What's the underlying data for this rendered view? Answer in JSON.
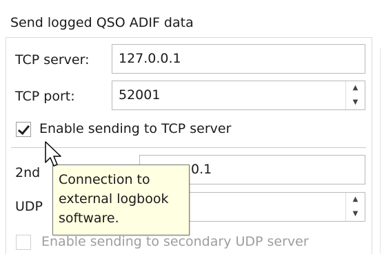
{
  "group": {
    "title": "Send logged QSO ADIF data"
  },
  "tcp_server": {
    "label": "TCP server:",
    "value": "127.0.0.1"
  },
  "tcp_port": {
    "label": "TCP port:",
    "value": "52001"
  },
  "enable_tcp": {
    "label": "Enable sending to TCP server",
    "checked": true
  },
  "udp_server": {
    "label_visible": "2nd",
    "value_visible": "0.1"
  },
  "udp_port": {
    "label_visible": "UDP"
  },
  "enable_udp": {
    "label": "Enable sending to secondary UDP server",
    "checked": false
  },
  "tooltip": {
    "text": "Connection to\nexternal logbook\nsoftware."
  },
  "spin_icons": {
    "up": "▲",
    "down": "▼"
  },
  "colors": {
    "tooltip_background": "#ffffe1",
    "disabled_text": "#9d9d9d"
  }
}
